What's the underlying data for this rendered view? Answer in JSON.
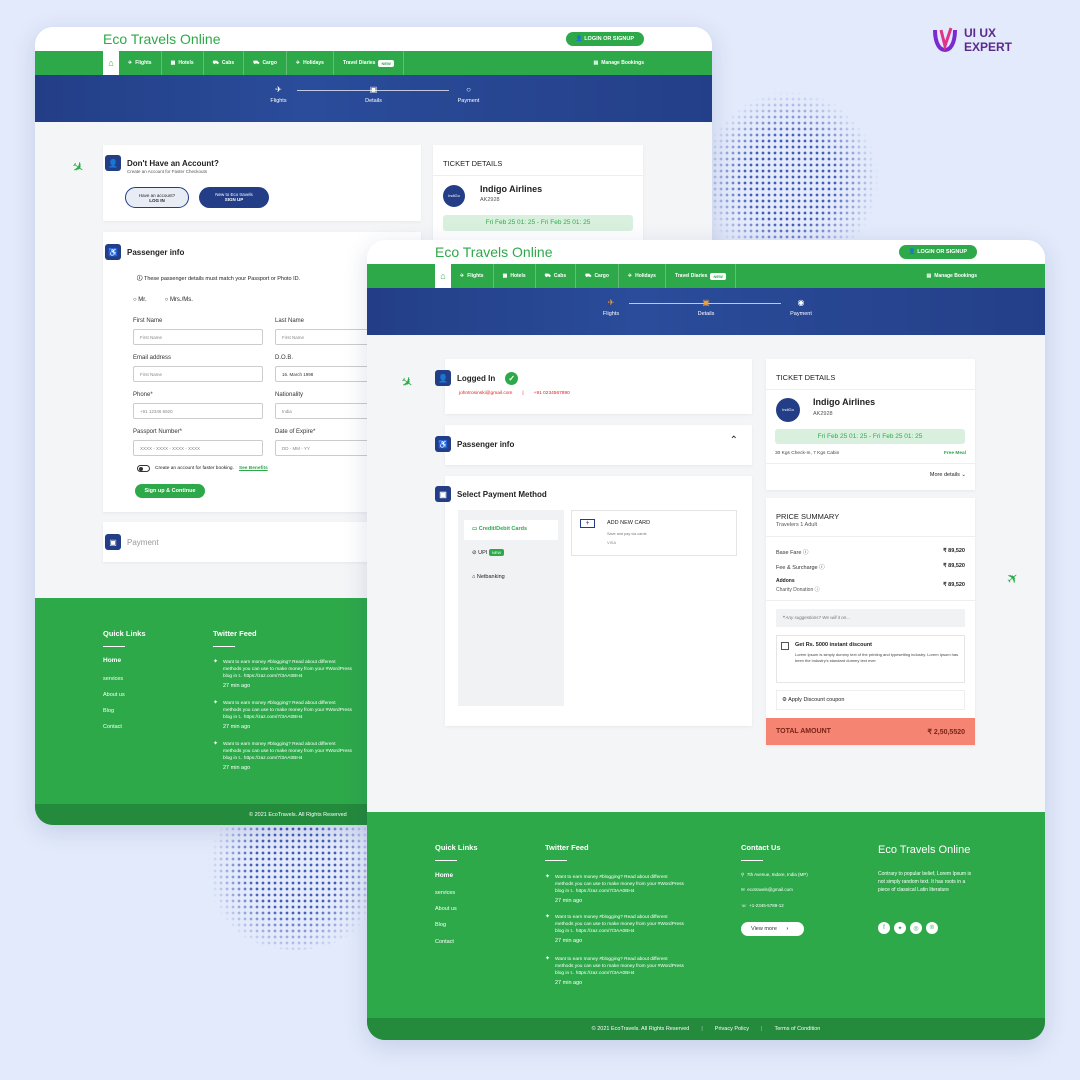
{
  "brand": {
    "line1": "UI UX",
    "line2": "EXPERT"
  },
  "site": {
    "logo": "Eco Travels Online",
    "login": "LOGIN OR SIGNUP",
    "nav": [
      "Flights",
      "Hotels",
      "Cabs",
      "Cargo",
      "Holidays",
      "Travel Diaries"
    ],
    "nav_new": "NEW",
    "manage": "Manage Bookings",
    "steps": [
      "Flights",
      "Details",
      "Payment"
    ]
  },
  "screen1": {
    "account": {
      "title": "Don't Have an Account?",
      "sub": "Create an Account for Faster Checkouts",
      "btn1a": "Have an account?",
      "btn1b": "LOG IN",
      "btn2a": "New to Eco travels",
      "btn2b": "SIGN UP"
    },
    "passenger": {
      "title": "Passenger info",
      "notice": "These passenger details must match your Passport or Photo ID.",
      "mr": "Mr.",
      "mrs": "Mrs./Ms.",
      "first": "First Name",
      "first_ph": "First Name",
      "last": "Last Name",
      "last_ph": "First Name",
      "email": "Email address",
      "email_ph": "First Name",
      "dob": "D.O.B.",
      "dob_val": "16. March 1998",
      "phone": "Phone*",
      "phone_ph": "+91 12346 6920",
      "nat": "Nationality",
      "nat_val": "India",
      "pass": "Passport Number*",
      "pass_ph": "XXXX - XXXX - XXXX - XXXX",
      "exp": "Date of Expire*",
      "exp_ph": "DD - MM - YY",
      "toggle": "Create an account for faster booking.",
      "benefits": "See Benefits",
      "submit": "Sign up & Continue"
    },
    "payment": "Payment",
    "ticket": {
      "title": "TICKET DETAILS",
      "airline": "Indigo Airlines",
      "code": "AK2928",
      "date": "Fri Feb 25 01: 25 - Fri Feb 25 01: 25"
    },
    "footer": {
      "ql": "Quick Links",
      "tf": "Twitter Feed",
      "links": [
        "Home",
        "services",
        "About us",
        "Blog",
        "Contact"
      ],
      "tweet": "Want to earn money #blogging? Read about different methods you can use to make money from your #WordPress blog in t.. https://zaz.com/7/3AA0BH4",
      "ago": "27 min ago",
      "copy": "© 2021 EcoTravels. All Rights Reserved"
    }
  },
  "screen2": {
    "logged": {
      "title": "Logged In",
      "email": "johntrosinski@gmail.com",
      "sep": "|",
      "phone": "+91 0234567890"
    },
    "passenger": "Passenger info",
    "pay": {
      "title": "Select Payment Method",
      "opts": [
        "Credit/Debit Cards",
        "UPI",
        "Netbanking"
      ],
      "new": "NEW",
      "add": "ADD NEW CARD",
      "save": "Save and pay via cards",
      "cards": "VISA"
    },
    "ticket": {
      "title": "TICKET DETAILS",
      "airline": "Indigo Airlines",
      "code": "AK2928",
      "date": "Fri Feb 25 01: 25 - Fri Feb 25 01: 25",
      "bag": "30 Kgs Check-In, 7 Kgs Cabin",
      "meal": "Free Meal",
      "more": "More details"
    },
    "price": {
      "title": "PRICE SUMMARY",
      "trav": "Travelers 1 Adult",
      "base": "Base Fare",
      "base_v": "₹ 89,520",
      "fee": "Fee & Surcharge",
      "fee_v": "₹ 89,520",
      "addons": "Addons",
      "charity": "Charity Donation",
      "add_v": "₹ 89,520",
      "sugg": "Any suggestions? We will it on...",
      "disc": "Get Rs. 5000 instant discount",
      "disc_txt": "Lorem Ipsum is simply dummy text of the printing and typesetting industry. Lorem Ipsum has been the industry's standard dummy text ever",
      "coupon": "Apply Discount coupon",
      "total": "TOTAL AMOUNT",
      "total_v": "₹ 2,50,5520"
    },
    "footer": {
      "ql": "Quick Links",
      "tf": "Twitter Feed",
      "cu": "Contact Us",
      "links": [
        "Home",
        "services",
        "About us",
        "Blog",
        "Contact"
      ],
      "tweet": "Want to earn money #blogging? Read about different methods you can use to make money from your #WordPress blog in t.. https://zaz.com/7/3AA0BH4",
      "ago": "27 min ago",
      "addr": "7th Avenue, Indore, India (MP)",
      "mail": "ecotravels@gmail.com",
      "tel": "+1-2345-5789-12",
      "view": "View more",
      "about": "Contrary to popular belief, Lorem Ipsum is not simply random text. It has roots in a piece of classical Latin literature",
      "copy": "© 2021 EcoTravels. All Rights Reserved",
      "privacy": "Privacy Policy",
      "terms": "Terms of Condition"
    }
  }
}
